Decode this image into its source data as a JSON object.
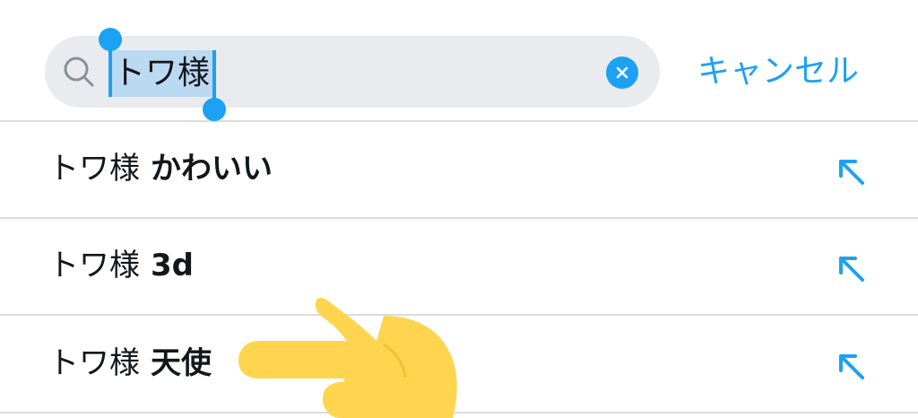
{
  "search": {
    "query": "トワ様",
    "cancel_label": "キャンセル",
    "icons": {
      "search": "search-icon",
      "clear": "clear-icon"
    }
  },
  "suggestions": [
    {
      "query": "トワ様",
      "completion": "かわいい",
      "icon": "fill-arrow-icon"
    },
    {
      "query": "トワ様",
      "completion": "3d",
      "icon": "fill-arrow-icon"
    },
    {
      "query": "トワ様",
      "completion": "天使",
      "icon": "fill-arrow-icon"
    }
  ],
  "overlay": {
    "icon": "pointing-hand-emoji",
    "color": "#ffd54f"
  },
  "colors": {
    "accent": "#1da1f2",
    "selection": "#bcd9f2",
    "field_background": "#e9ebee",
    "divider": "#d9dce0",
    "text": "#14171a"
  }
}
